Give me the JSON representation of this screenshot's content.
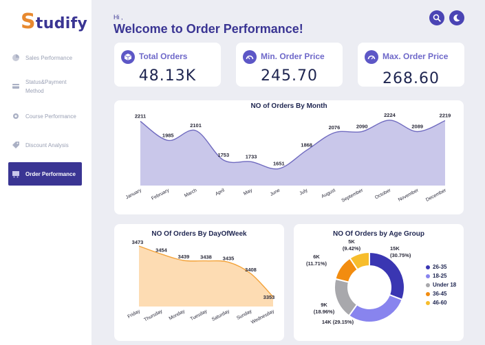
{
  "app": {
    "logo_initial": "S",
    "logo_rest": "tudify"
  },
  "sidebar": {
    "items": [
      {
        "label": "Sales Performance",
        "active": false
      },
      {
        "label": "Status&Payment",
        "label2": "Method",
        "active": false
      },
      {
        "label": "Course Performance",
        "active": false
      },
      {
        "label": "Discount Analysis",
        "active": false
      },
      {
        "label": "Order Performance",
        "active": true
      }
    ]
  },
  "header": {
    "greeting": "Hi ,",
    "title": "Welcome to Order Performance!"
  },
  "kpis": [
    {
      "title": "Total Orders",
      "value": "48.13K",
      "icon": "cube-icon"
    },
    {
      "title": "Min. Order Price",
      "value": "245.70",
      "icon": "gauge-icon"
    },
    {
      "title": "Max. Order Price",
      "value": "268.60",
      "icon": "gauge-icon"
    }
  ],
  "colors": {
    "brand": "#3a3593",
    "area_month": "#c9c7ea",
    "area_week": "#fddcb3",
    "line_week": "#f3a33b"
  },
  "chart_data": [
    {
      "type": "area",
      "title": "NO of Orders By Month",
      "categories": [
        "January",
        "February",
        "March",
        "April",
        "May",
        "June",
        "July",
        "August",
        "September",
        "October",
        "November",
        "December"
      ],
      "values": [
        2211,
        1985,
        2101,
        1753,
        1733,
        1651,
        1868,
        2076,
        2090,
        2224,
        2089,
        2219
      ],
      "data_labels": [
        "2211",
        "1985",
        "2101",
        "1753",
        "1733",
        "1651",
        "1868",
        "2076",
        "2090",
        "2224",
        "2089",
        "2219"
      ]
    },
    {
      "type": "area",
      "title": "NO Of Orders By DayOfWeek",
      "categories": [
        "Friday",
        "Thursday",
        "Monday",
        "Tuesday",
        "Saturday",
        "Sunday",
        "Wednesday"
      ],
      "values": [
        3473,
        3454,
        3439,
        3438,
        3435,
        3408,
        3353
      ],
      "data_labels": [
        "3473",
        "3454",
        "3439",
        "3438",
        "3435",
        "3408",
        "3353"
      ]
    },
    {
      "type": "pie",
      "title": "NO Of Orders by Age Group",
      "categories": [
        "26-35",
        "18-25",
        "Under 18",
        "36-45",
        "46-60"
      ],
      "values": [
        30.75,
        29.15,
        18.96,
        11.71,
        9.42
      ],
      "slice_labels": [
        [
          "15K",
          "(30.75%)"
        ],
        [
          "14K (29.15%)"
        ],
        [
          "9K",
          "(18.96%)"
        ],
        [
          "6K",
          "(11.71%)"
        ],
        [
          "5K",
          "(9.42%)"
        ]
      ],
      "colors": [
        "#3a36b2",
        "#8884ee",
        "#a8a8ac",
        "#f28c0f",
        "#f7bd2c"
      ],
      "legend_position": "right"
    }
  ]
}
